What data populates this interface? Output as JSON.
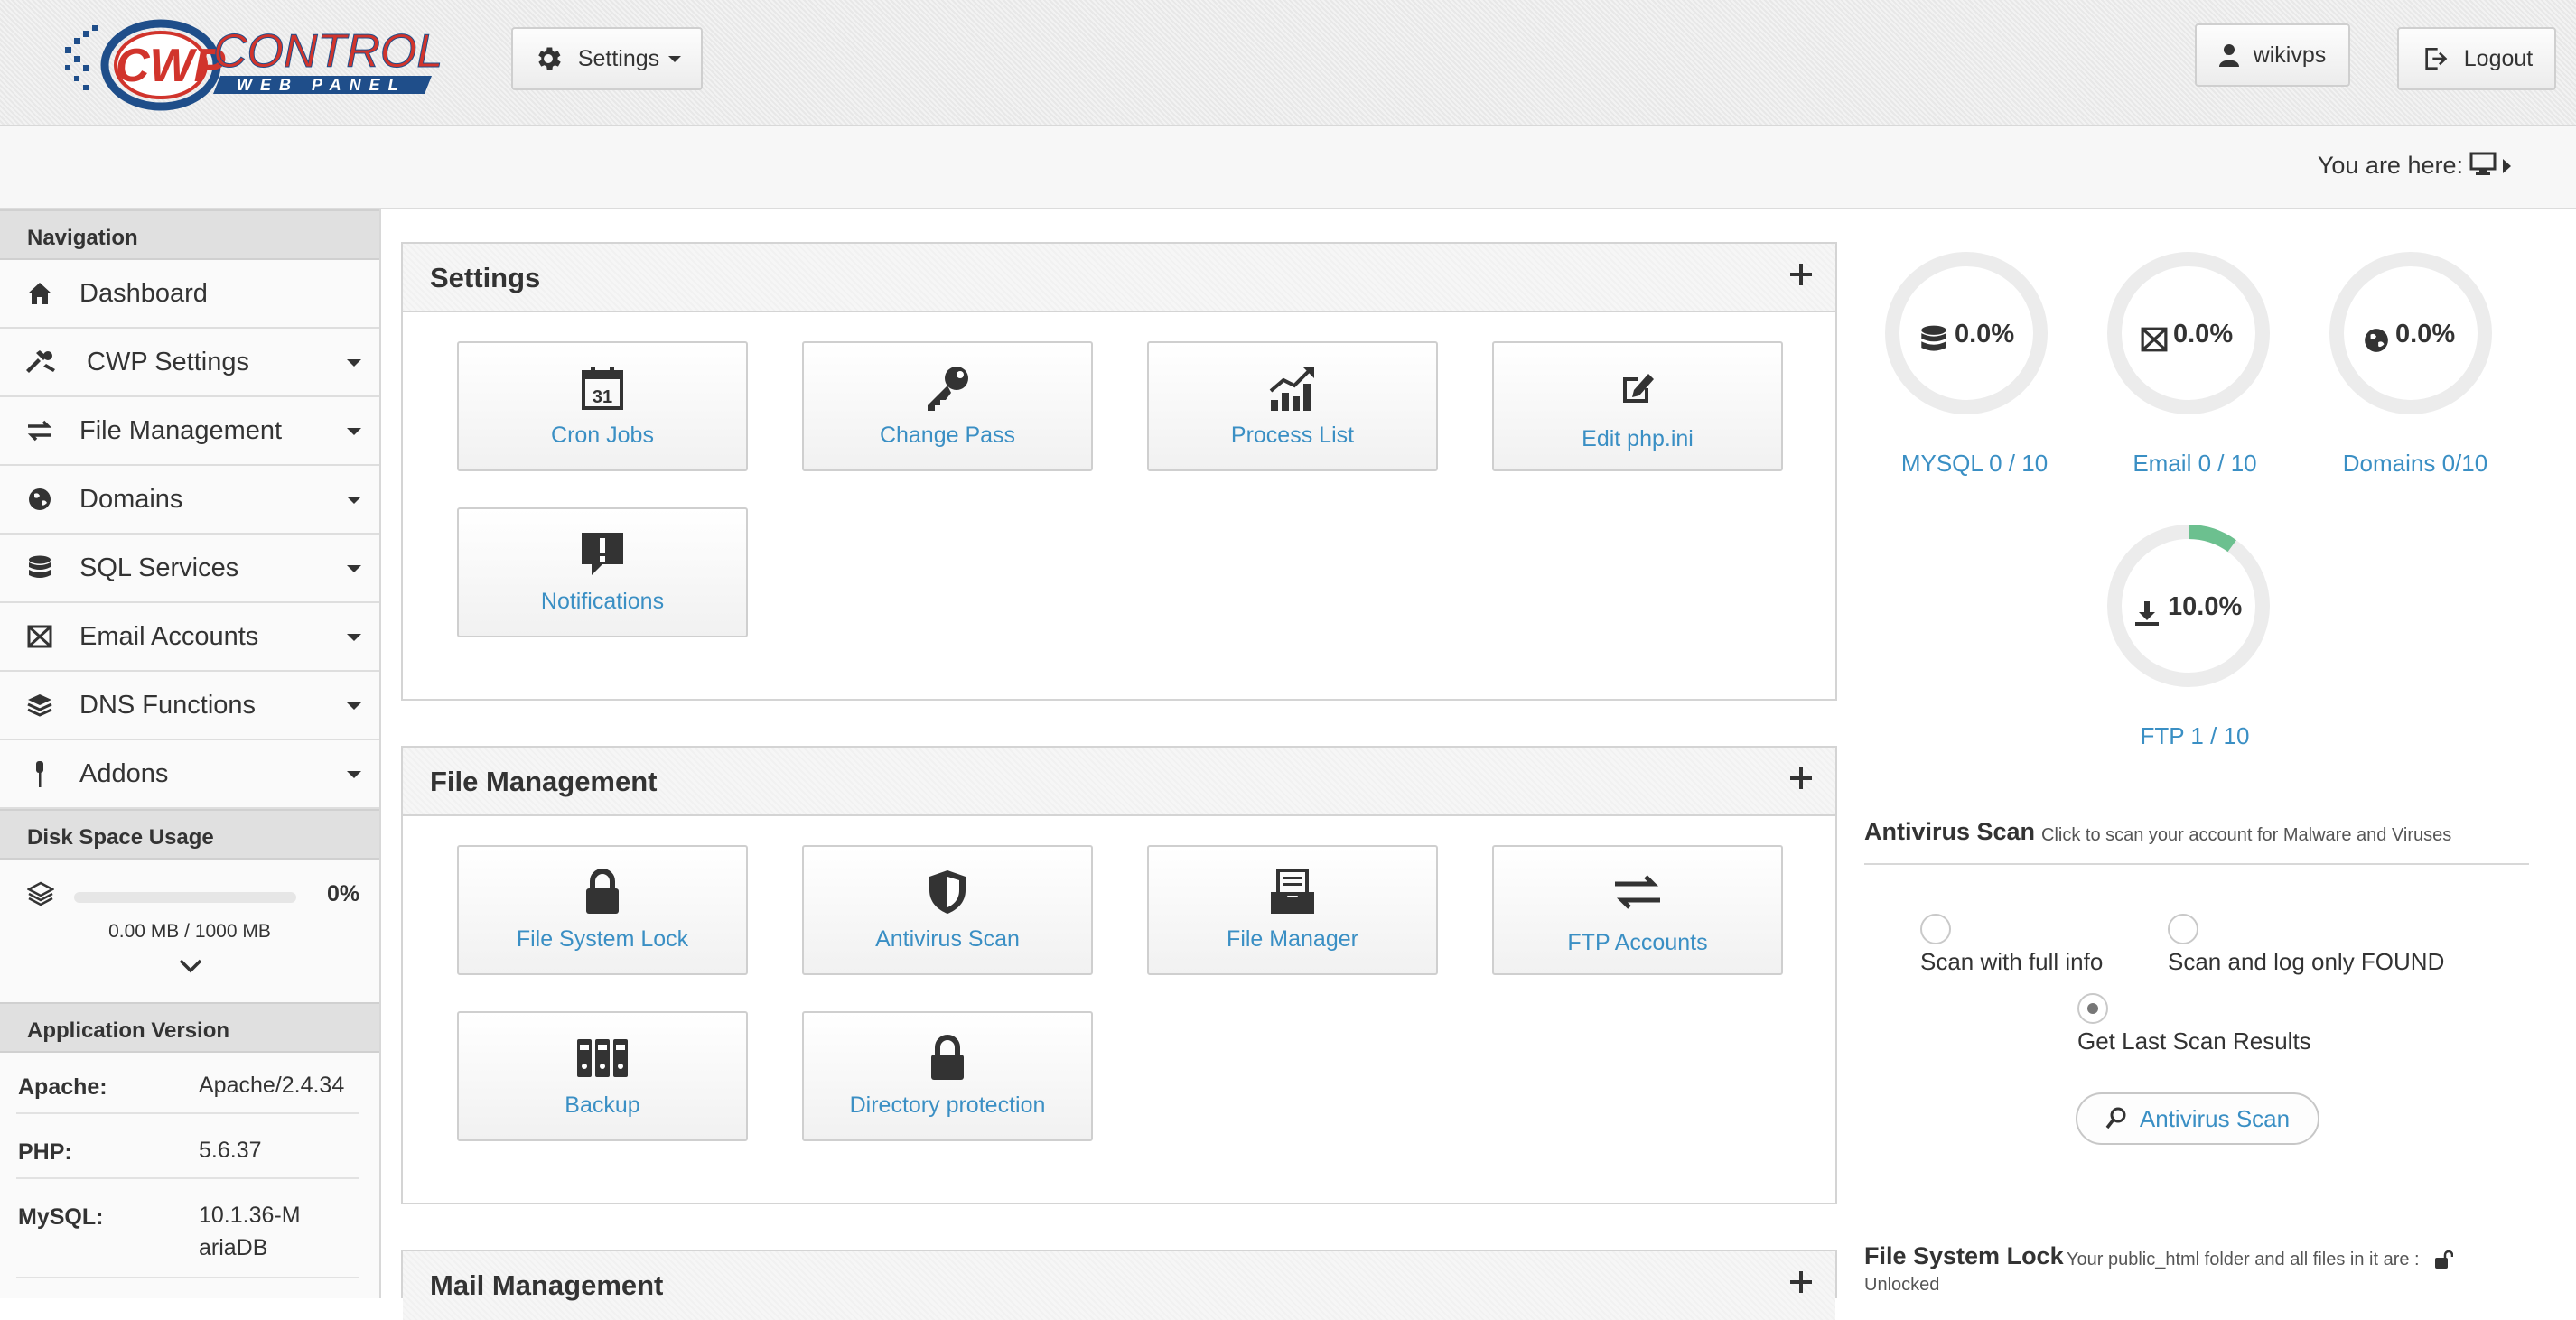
{
  "header": {
    "logo_text": "CWP CONTROL WEB PANEL",
    "settings_label": "Settings",
    "user_label": "wikivps",
    "logout_label": "Logout"
  },
  "breadcrumb": {
    "label": "You are here:",
    "icon": "monitor-icon"
  },
  "sidebar": {
    "navigation_title": "Navigation",
    "items": [
      {
        "label": "Dashboard",
        "icon": "home-icon",
        "has_submenu": false
      },
      {
        "label": "CWP Settings",
        "icon": "tools-icon",
        "has_submenu": true
      },
      {
        "label": "File Management",
        "icon": "exchange-icon",
        "has_submenu": true
      },
      {
        "label": "Domains",
        "icon": "globe-icon",
        "has_submenu": true
      },
      {
        "label": "SQL Services",
        "icon": "database-icon",
        "has_submenu": true
      },
      {
        "label": "Email Accounts",
        "icon": "envelope-icon",
        "has_submenu": true
      },
      {
        "label": "DNS Functions",
        "icon": "layers-icon",
        "has_submenu": true
      },
      {
        "label": "Addons",
        "icon": "plug-icon",
        "has_submenu": true
      }
    ],
    "disk_title": "Disk Space Usage",
    "disk_percent": "0%",
    "disk_fraction": 0,
    "disk_usage": "0.00 MB / 1000 MB",
    "app_version_title": "Application Version",
    "versions": [
      {
        "key": "Apache:",
        "value": "Apache/2.4.34"
      },
      {
        "key": "PHP:",
        "value": "5.6.37"
      },
      {
        "key": "MySQL:",
        "value": "10.1.36-MariaDB"
      }
    ]
  },
  "panels": {
    "settings": {
      "title": "Settings",
      "tiles": [
        {
          "label": "Cron Jobs",
          "icon": "calendar-icon"
        },
        {
          "label": "Change Pass",
          "icon": "key-icon"
        },
        {
          "label": "Process List",
          "icon": "chart-icon"
        },
        {
          "label": "Edit php.ini",
          "icon": "edit-icon"
        },
        {
          "label": "Notifications",
          "icon": "notification-icon"
        }
      ]
    },
    "file_management": {
      "title": "File Management",
      "tiles": [
        {
          "label": "File System Lock",
          "icon": "lock-icon"
        },
        {
          "label": "Antivirus Scan",
          "icon": "shield-icon"
        },
        {
          "label": "File Manager",
          "icon": "inbox-icon"
        },
        {
          "label": "FTP Accounts",
          "icon": "exchange-icon"
        },
        {
          "label": "Backup",
          "icon": "binders-icon"
        },
        {
          "label": "Directory protection",
          "icon": "lock-icon"
        }
      ]
    },
    "mail_management": {
      "title": "Mail Management"
    }
  },
  "usage": [
    {
      "value": "0.0%",
      "fraction": 0.0,
      "label": "MYSQL 0 / 10",
      "icon": "database-icon"
    },
    {
      "value": "0.0%",
      "fraction": 0.0,
      "label": "Email 0 / 10",
      "icon": "envelope-icon"
    },
    {
      "value": "0.0%",
      "fraction": 0.0,
      "label": "Domains 0/10",
      "icon": "globe-icon"
    },
    {
      "value": "10.0%",
      "fraction": 0.1,
      "label": "FTP 1 / 10",
      "icon": "download-icon"
    }
  ],
  "antivirus": {
    "title": "Antivirus Scan",
    "subtitle": "Click to scan your account for Malware and Viruses",
    "options": [
      "Scan with full info",
      "Scan and log only FOUND",
      "Get Last Scan Results"
    ],
    "selected_option": "Get Last Scan Results",
    "button_label": "Antivirus Scan"
  },
  "file_system_lock": {
    "title": "File System Lock",
    "subtitle": "Your public_html folder and all files in it are :",
    "status": "Unlocked"
  },
  "colors": {
    "accent": "#3a8fc4",
    "donut_track": "#ececec",
    "donut_fill": "#6cc08f",
    "brand_red": "#d1342c",
    "brand_blue": "#1f4e8a"
  }
}
